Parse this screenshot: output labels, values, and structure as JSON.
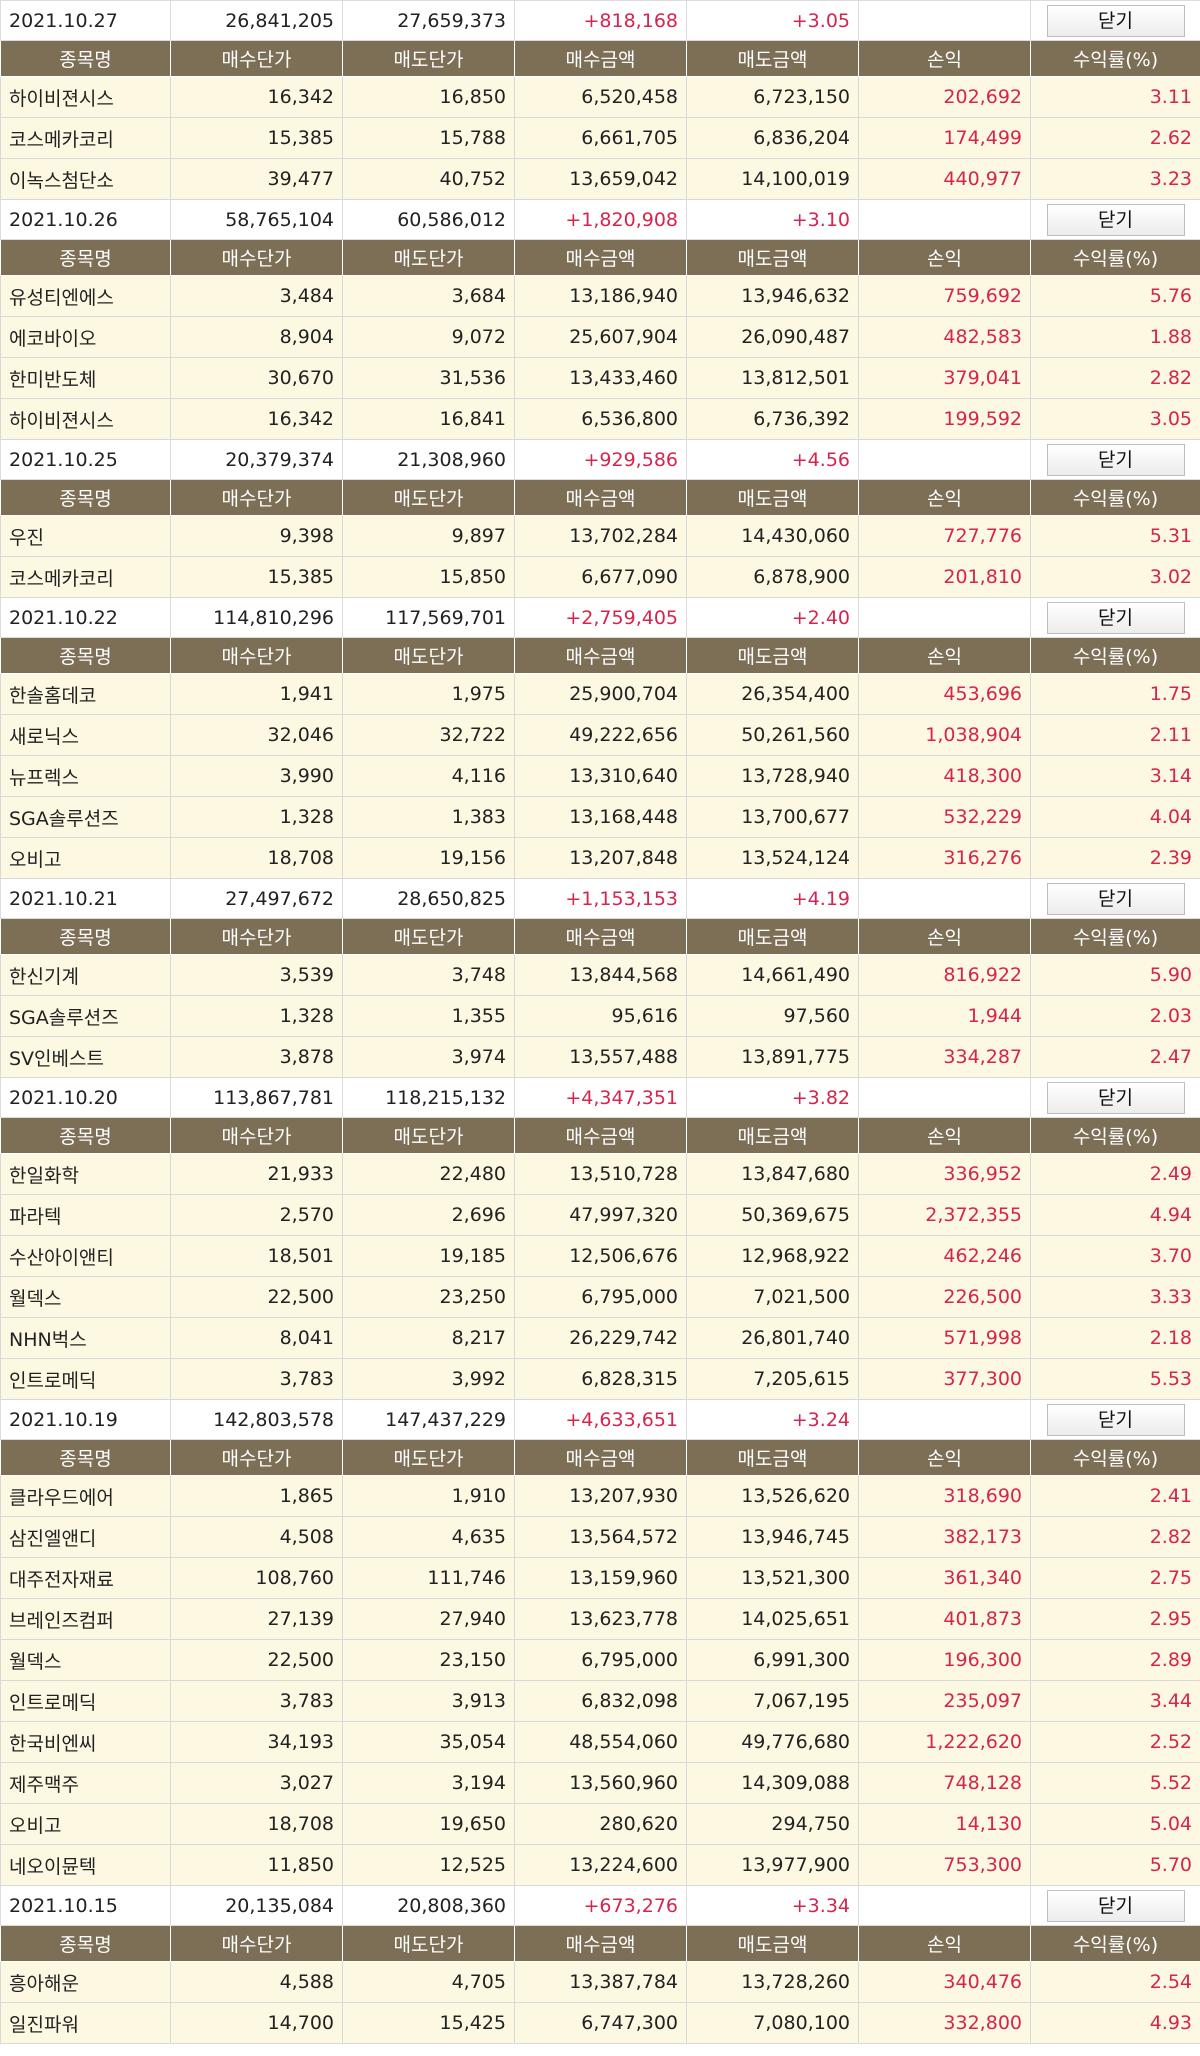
{
  "columns": [
    "종목명",
    "매수단가",
    "매도단가",
    "매수금액",
    "매도금액",
    "손익",
    "수익률(%)"
  ],
  "close_label": "닫기",
  "days": [
    {
      "date": "2021.10.27",
      "buy_total": "26,841,205",
      "sell_total": "27,659,373",
      "profit": "+818,168",
      "rate": "+3.05",
      "stocks": [
        [
          "하이비젼시스",
          "16,342",
          "16,850",
          "6,520,458",
          "6,723,150",
          "202,692",
          "3.11"
        ],
        [
          "코스메카코리",
          "15,385",
          "15,788",
          "6,661,705",
          "6,836,204",
          "174,499",
          "2.62"
        ],
        [
          "이녹스첨단소",
          "39,477",
          "40,752",
          "13,659,042",
          "14,100,019",
          "440,977",
          "3.23"
        ]
      ]
    },
    {
      "date": "2021.10.26",
      "buy_total": "58,765,104",
      "sell_total": "60,586,012",
      "profit": "+1,820,908",
      "rate": "+3.10",
      "stocks": [
        [
          "유성티엔에스",
          "3,484",
          "3,684",
          "13,186,940",
          "13,946,632",
          "759,692",
          "5.76"
        ],
        [
          "에코바이오",
          "8,904",
          "9,072",
          "25,607,904",
          "26,090,487",
          "482,583",
          "1.88"
        ],
        [
          "한미반도체",
          "30,670",
          "31,536",
          "13,433,460",
          "13,812,501",
          "379,041",
          "2.82"
        ],
        [
          "하이비젼시스",
          "16,342",
          "16,841",
          "6,536,800",
          "6,736,392",
          "199,592",
          "3.05"
        ]
      ]
    },
    {
      "date": "2021.10.25",
      "buy_total": "20,379,374",
      "sell_total": "21,308,960",
      "profit": "+929,586",
      "rate": "+4.56",
      "stocks": [
        [
          "우진",
          "9,398",
          "9,897",
          "13,702,284",
          "14,430,060",
          "727,776",
          "5.31"
        ],
        [
          "코스메카코리",
          "15,385",
          "15,850",
          "6,677,090",
          "6,878,900",
          "201,810",
          "3.02"
        ]
      ]
    },
    {
      "date": "2021.10.22",
      "buy_total": "114,810,296",
      "sell_total": "117,569,701",
      "profit": "+2,759,405",
      "rate": "+2.40",
      "stocks": [
        [
          "한솔홈데코",
          "1,941",
          "1,975",
          "25,900,704",
          "26,354,400",
          "453,696",
          "1.75"
        ],
        [
          "새로닉스",
          "32,046",
          "32,722",
          "49,222,656",
          "50,261,560",
          "1,038,904",
          "2.11"
        ],
        [
          "뉴프렉스",
          "3,990",
          "4,116",
          "13,310,640",
          "13,728,940",
          "418,300",
          "3.14"
        ],
        [
          "SGA솔루션즈",
          "1,328",
          "1,383",
          "13,168,448",
          "13,700,677",
          "532,229",
          "4.04"
        ],
        [
          "오비고",
          "18,708",
          "19,156",
          "13,207,848",
          "13,524,124",
          "316,276",
          "2.39"
        ]
      ]
    },
    {
      "date": "2021.10.21",
      "buy_total": "27,497,672",
      "sell_total": "28,650,825",
      "profit": "+1,153,153",
      "rate": "+4.19",
      "stocks": [
        [
          "한신기계",
          "3,539",
          "3,748",
          "13,844,568",
          "14,661,490",
          "816,922",
          "5.90"
        ],
        [
          "SGA솔루션즈",
          "1,328",
          "1,355",
          "95,616",
          "97,560",
          "1,944",
          "2.03"
        ],
        [
          "SV인베스트",
          "3,878",
          "3,974",
          "13,557,488",
          "13,891,775",
          "334,287",
          "2.47"
        ]
      ]
    },
    {
      "date": "2021.10.20",
      "buy_total": "113,867,781",
      "sell_total": "118,215,132",
      "profit": "+4,347,351",
      "rate": "+3.82",
      "stocks": [
        [
          "한일화학",
          "21,933",
          "22,480",
          "13,510,728",
          "13,847,680",
          "336,952",
          "2.49"
        ],
        [
          "파라텍",
          "2,570",
          "2,696",
          "47,997,320",
          "50,369,675",
          "2,372,355",
          "4.94"
        ],
        [
          "수산아이앤티",
          "18,501",
          "19,185",
          "12,506,676",
          "12,968,922",
          "462,246",
          "3.70"
        ],
        [
          "월덱스",
          "22,500",
          "23,250",
          "6,795,000",
          "7,021,500",
          "226,500",
          "3.33"
        ],
        [
          "NHN벅스",
          "8,041",
          "8,217",
          "26,229,742",
          "26,801,740",
          "571,998",
          "2.18"
        ],
        [
          "인트로메딕",
          "3,783",
          "3,992",
          "6,828,315",
          "7,205,615",
          "377,300",
          "5.53"
        ]
      ]
    },
    {
      "date": "2021.10.19",
      "buy_total": "142,803,578",
      "sell_total": "147,437,229",
      "profit": "+4,633,651",
      "rate": "+3.24",
      "stocks": [
        [
          "클라우드에어",
          "1,865",
          "1,910",
          "13,207,930",
          "13,526,620",
          "318,690",
          "2.41"
        ],
        [
          "삼진엘앤디",
          "4,508",
          "4,635",
          "13,564,572",
          "13,946,745",
          "382,173",
          "2.82"
        ],
        [
          "대주전자재료",
          "108,760",
          "111,746",
          "13,159,960",
          "13,521,300",
          "361,340",
          "2.75"
        ],
        [
          "브레인즈컴퍼",
          "27,139",
          "27,940",
          "13,623,778",
          "14,025,651",
          "401,873",
          "2.95"
        ],
        [
          "월덱스",
          "22,500",
          "23,150",
          "6,795,000",
          "6,991,300",
          "196,300",
          "2.89"
        ],
        [
          "인트로메딕",
          "3,783",
          "3,913",
          "6,832,098",
          "7,067,195",
          "235,097",
          "3.44"
        ],
        [
          "한국비엔씨",
          "34,193",
          "35,054",
          "48,554,060",
          "49,776,680",
          "1,222,620",
          "2.52"
        ],
        [
          "제주맥주",
          "3,027",
          "3,194",
          "13,560,960",
          "14,309,088",
          "748,128",
          "5.52"
        ],
        [
          "오비고",
          "18,708",
          "19,650",
          "280,620",
          "294,750",
          "14,130",
          "5.04"
        ],
        [
          "네오이뮨텍",
          "11,850",
          "12,525",
          "13,224,600",
          "13,977,900",
          "753,300",
          "5.70"
        ]
      ]
    },
    {
      "date": "2021.10.15",
      "buy_total": "20,135,084",
      "sell_total": "20,808,360",
      "profit": "+673,276",
      "rate": "+3.34",
      "stocks": [
        [
          "흥아해운",
          "4,588",
          "4,705",
          "13,387,784",
          "13,728,260",
          "340,476",
          "2.54"
        ],
        [
          "일진파워",
          "14,700",
          "15,425",
          "6,747,300",
          "7,080,100",
          "332,800",
          "4.93"
        ]
      ]
    }
  ]
}
